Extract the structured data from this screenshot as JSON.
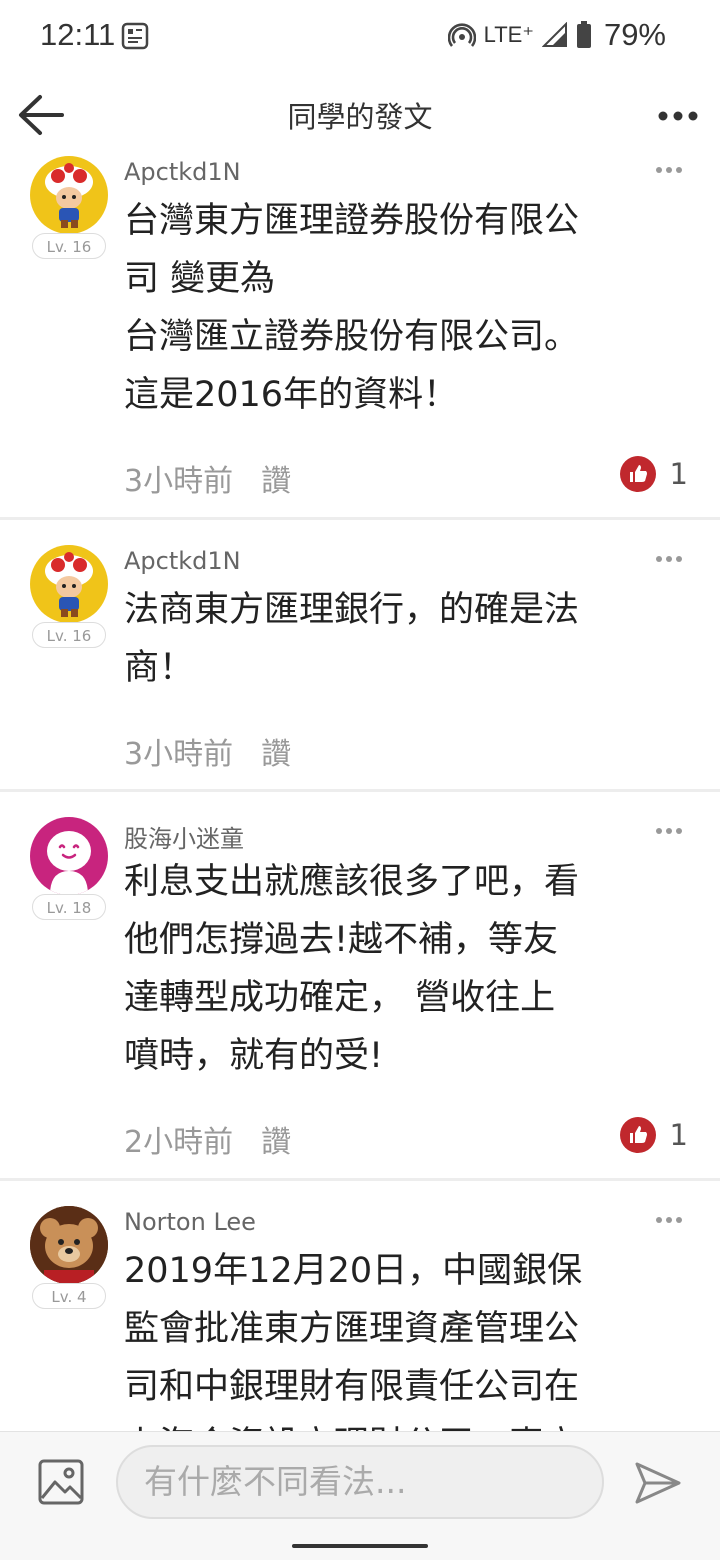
{
  "status_bar": {
    "time": "12:11",
    "network": "LTE⁺",
    "battery": "79%"
  },
  "header": {
    "title": "同學的發文"
  },
  "posts": [
    {
      "author": "Apctkd1N",
      "level": "Lv. 16",
      "lines": [
        "台灣東方匯理證券股份有限公",
        "司 變更為",
        "台灣匯立證券股份有限公司。",
        "這是2016年的資料！"
      ],
      "time": "3小時前",
      "like_label": "讚",
      "like_count": "1"
    },
    {
      "author": "Apctkd1N",
      "level": "Lv. 16",
      "lines": [
        "法商東方匯理銀行，的確是法",
        "商！"
      ],
      "time": "3小時前",
      "like_label": "讚"
    },
    {
      "author": "股海小迷童",
      "level": "Lv. 18",
      "lines": [
        "利息支出就應該很多了吧，看",
        "他們怎撐過去!越不補，等友",
        "達轉型成功確定， 營收往上",
        "噴時，就有的受!"
      ],
      "time": "2小時前",
      "like_label": "讚",
      "like_count": "1"
    },
    {
      "author": "Norton Lee",
      "level": "Lv. 4",
      "lines": [
        "2019年12月20日，中國銀保",
        "監會批准東方匯理資產管理公",
        "司和中銀理財有限責任公司在",
        "上海合資設立理財公司，專立"
      ]
    }
  ],
  "composer": {
    "placeholder": "有什麼不同看法..."
  }
}
